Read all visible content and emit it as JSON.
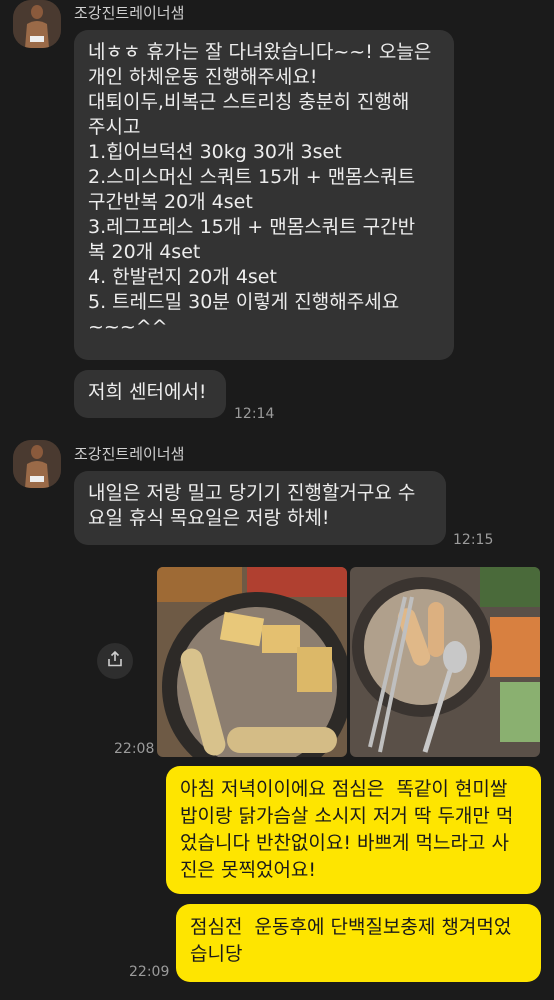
{
  "messages": [
    {
      "sender": "조강진트레이너샘",
      "text": "네ㅎㅎ 휴가는 잘 다녀왔습니다~~! 오늘은\n개인 하체운동 진행해주세요!\n대퇴이두,비복근 스트리칭 충분히 진행해\n주시고\n1.힙어브덕션 30kg 30개 3set\n2.스미스머신 스쿼트 15개 + 맨몸스쿼트\n구간반복 20개 4set\n3.레그프레스 15개 + 맨몸스쿼트 구간반\n복 20개 4set\n4. 한발런지 20개 4set\n5. 트레드밀 30분 이렇게 진행해주세요\n~~~^^"
    },
    {
      "text": "저희 센터에서!",
      "time": "12:14"
    },
    {
      "sender": "조강진트레이너샘",
      "text": "내일은 저랑 밀고 당기기 진행할거구요 수\n요일 휴식 목요일은 저랑 하체!",
      "time": "12:15"
    },
    {
      "time": "22:08"
    },
    {
      "text": "아침 저녁이이에요 점심은  똑같이 현미쌀\n밥이랑 닭가슴살 소시지 저거 딱 두개만 먹\n었습니다 반찬없이요! 바쁘게 먹느라고 사\n진은 못찍었어요!"
    },
    {
      "text": "점심전  운동후에 단백질보충제 챙겨먹었\n습니당",
      "time": "22:09"
    }
  ],
  "icons": {
    "share": "share-icon"
  },
  "colors": {
    "background": "#1b1b1b",
    "incoming_bubble": "#333333",
    "outgoing_bubble": "#fee500"
  }
}
